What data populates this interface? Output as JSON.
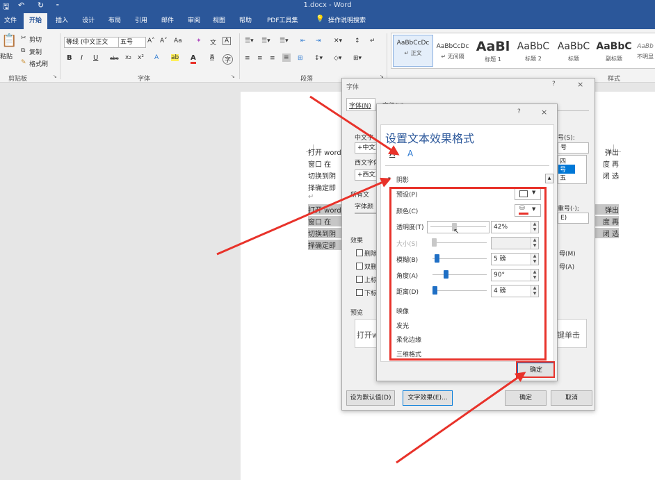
{
  "window": {
    "title": "1.docx  -  Word",
    "quick_access": [
      "🖫",
      "↶",
      "↻",
      "⁃"
    ]
  },
  "tabs": [
    "文件",
    "开始",
    "插入",
    "设计",
    "布局",
    "引用",
    "邮件",
    "审阅",
    "视图",
    "帮助",
    "PDF工具集",
    "操作说明搜索"
  ],
  "ribbon": {
    "clipboard": {
      "paste": "粘贴",
      "cut": "剪切",
      "copy": "复制",
      "format_painter": "格式刷",
      "group": "剪贴板"
    },
    "font": {
      "font_name": "等线 (中文正文",
      "font_size": "五号",
      "group": "字体",
      "aa": "Aa"
    },
    "paragraph": {
      "group": "段落"
    },
    "styles": {
      "group": "样式",
      "items": [
        {
          "sample": "AaBbCcDc",
          "name": "↵ 正文"
        },
        {
          "sample": "AaBbCcDc",
          "name": "↵ 无间隔"
        },
        {
          "sample": "AaBl",
          "name": "标题 1"
        },
        {
          "sample": "AaBbC",
          "name": "标题 2"
        },
        {
          "sample": "AaBbC",
          "name": "标题"
        },
        {
          "sample": "AaBbC",
          "name": "副标题"
        },
        {
          "sample": "AaBb",
          "name": "不明显"
        }
      ]
    }
  },
  "document": {
    "lines_left": [
      "打开 word",
      "窗口  在",
      "切换到阴",
      "择确定即",
      "↵",
      "打开 word",
      "窗口  在",
      "切换到阴",
      "择确定即"
    ],
    "lines_right": [
      "弹出",
      "度  再",
      "闭  选",
      "",
      "",
      "弹出",
      "度  再",
      "闭  选"
    ]
  },
  "font_dialog": {
    "title": "字体",
    "help": "?",
    "close": "×",
    "tabs": [
      "字体(N)",
      "高级(V)"
    ],
    "chinese_font_label": "中文字",
    "chinese_font_value": "+中文正",
    "western_font_label": "西文字体",
    "western_font_value": "+西文正",
    "all_text_label": "所有文",
    "font_color_label": "字体颜",
    "size_label": "号(S):",
    "size_value": "号",
    "size_list": [
      "四",
      "号",
      "五"
    ],
    "emphasis_label": "重号(·);",
    "emphasis_value": "E)",
    "effects_label": "效果",
    "effects": [
      "删除",
      "双删",
      "上标",
      "下标"
    ],
    "effects_right": [
      "母(M)",
      "母(A)"
    ],
    "preview_label": "预览",
    "preview_text": "打开w",
    "preview_right": "键单击",
    "set_default": "设为默认值(D)",
    "text_effects": "文字效果(E)...",
    "ok": "确定",
    "cancel": "取消"
  },
  "effects_dialog": {
    "help": "?",
    "close": "×",
    "title": "设置文本效果格式",
    "section": "阴影",
    "props": {
      "preset": "预设(P)",
      "color": "颜色(C)",
      "transparency": "透明度(T)",
      "transparency_value": "42%",
      "transparency_level": 0.42,
      "size": "大小(S)",
      "blur": "模糊(B)",
      "blur_value": "5 磅",
      "angle": "角度(A)",
      "angle_value": "90°",
      "distance": "距离(D)",
      "distance_value": "4 磅"
    },
    "other_sections": [
      "映像",
      "发光",
      "柔化边缘",
      "三维格式"
    ],
    "ok": "确定"
  },
  "colors": {
    "ribbon_blue": "#2b579a",
    "annotation_red": "#e8322a",
    "slider_blue": "#1f6fc5"
  }
}
